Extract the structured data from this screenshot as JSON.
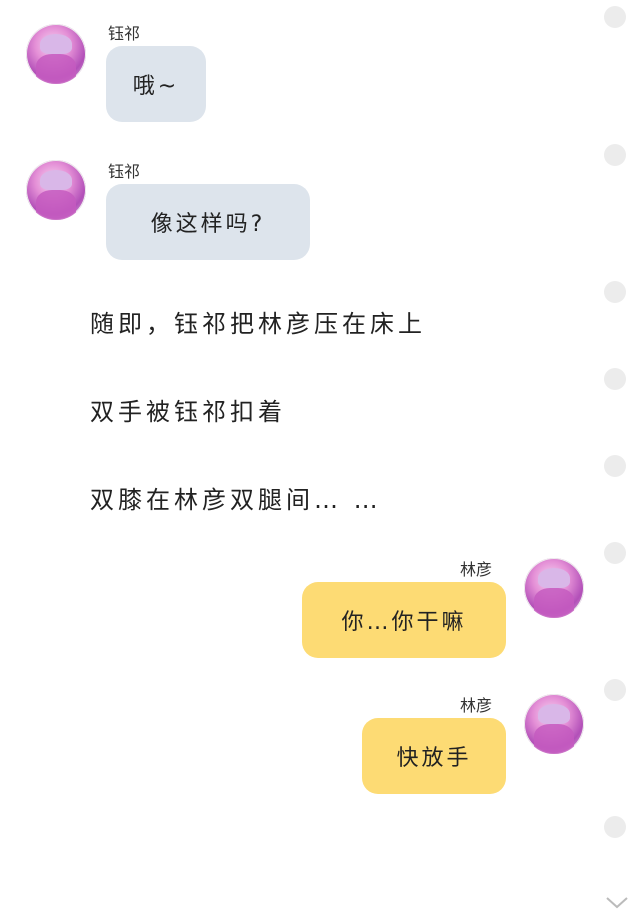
{
  "messages": [
    {
      "sender": "钰祁",
      "text": "哦~"
    },
    {
      "sender": "钰祁",
      "text": "像这样吗?"
    },
    {
      "sender": "林彦",
      "text": "你…你干嘛"
    },
    {
      "sender": "林彦",
      "text": "快放手"
    }
  ],
  "narration": [
    "随即，钰祁把林彦压在床上",
    "双手被钰祁扣着",
    "双膝在林彦双腿间… …"
  ],
  "colors": {
    "left_bubble": "#dde4ec",
    "right_bubble": "#fddb74",
    "dot": "#ececec"
  },
  "icons": {
    "scroll": "chevron-down-icon"
  }
}
